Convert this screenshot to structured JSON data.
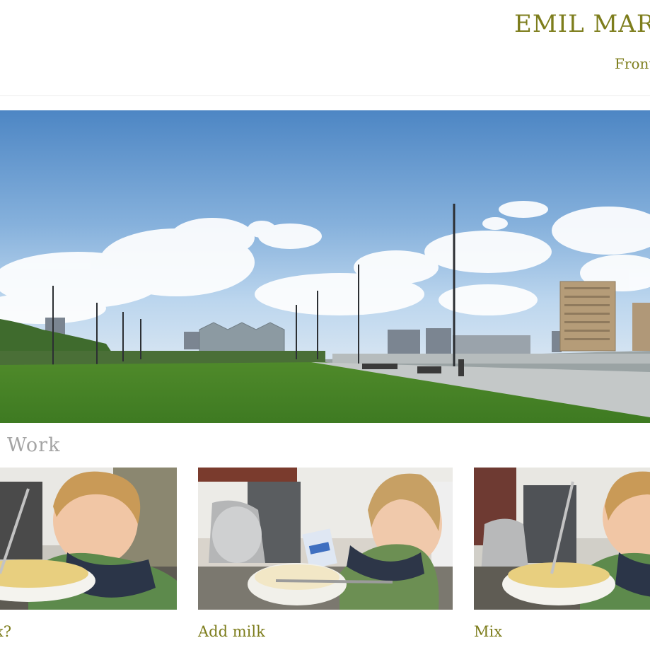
{
  "header": {
    "site_title": "EMIL MART",
    "tagline": "Front"
  },
  "hero": {
    "image_name": "rooftop-park-panorama"
  },
  "work": {
    "heading": "Work",
    "items": [
      {
        "caption": "x?",
        "image_name": "child-whisking-bowl"
      },
      {
        "caption": "Add milk",
        "image_name": "child-pouring-milk"
      },
      {
        "caption": "Mix",
        "image_name": "child-mixing-bowl"
      }
    ]
  },
  "colors": {
    "accent": "#7d7d1c",
    "heading_gray": "#a4a4a4",
    "divider": "#ebebeb"
  }
}
